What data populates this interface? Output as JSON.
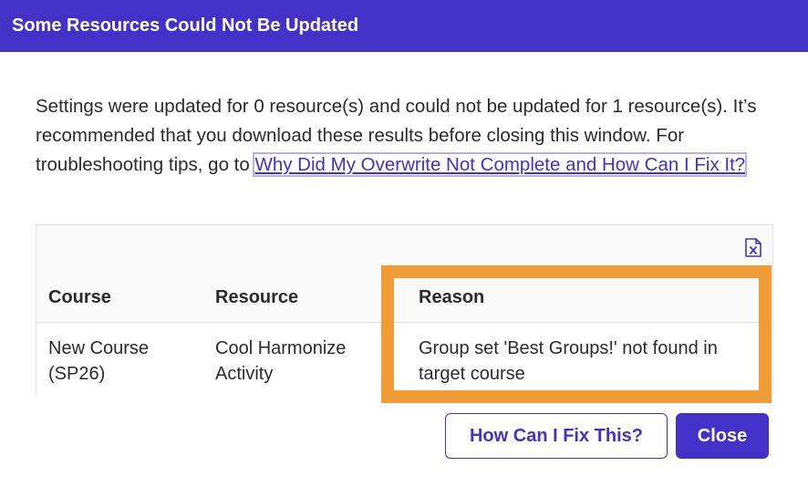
{
  "dialog": {
    "title": "Some Resources Could Not Be Updated",
    "message_text": "Settings were updated for 0 resource(s) and could not be updated for 1 resource(s). It’s recommended that you download these results before closing this window. For troubleshooting tips, go to ",
    "help_link": "Why Did My Overwrite Not Complete and How Can I Fix It?"
  },
  "table": {
    "download_icon": "excel-file-icon",
    "headers": {
      "course": "Course",
      "resource": "Resource",
      "reason": "Reason"
    },
    "rows": [
      {
        "course": "New Course (SP26)",
        "resource": "Cool Harmonize Activity",
        "reason": "Group set 'Best Groups!' not found in target course"
      }
    ]
  },
  "buttons": {
    "fix": "How Can I Fix This?",
    "close": "Close"
  },
  "colors": {
    "brand": "#4432c8",
    "highlight": "#f19d37"
  }
}
